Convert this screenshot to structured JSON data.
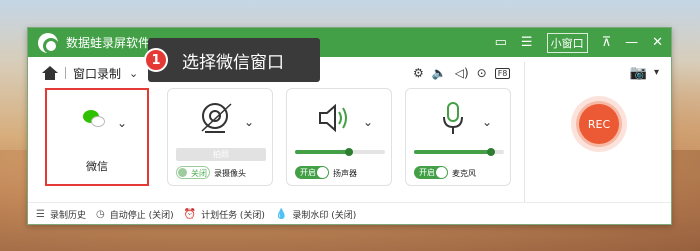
{
  "app": {
    "title": "数据蛙录屏软件"
  },
  "titlebar": {
    "mini_window": "小窗口",
    "menu_icon": "menu-icon",
    "pin_icon": "pin-icon"
  },
  "callout": {
    "number": "1",
    "text": "选择微信窗口"
  },
  "toolbar": {
    "mode": "窗口录制"
  },
  "sources": {
    "window": {
      "label": "微信"
    },
    "webcam": {
      "photo_button": "拍照",
      "toggle": "关闭",
      "label": "录摄像头"
    },
    "speaker": {
      "toggle": "开启",
      "label": "扬声器",
      "level": 0.6
    },
    "mic": {
      "toggle": "开启",
      "label": "麦克风",
      "level": 0.85
    }
  },
  "rec": {
    "label": "REC"
  },
  "bottombar": {
    "history": "录制历史",
    "auto_stop": "自动停止 (关闭)",
    "schedule": "计划任务 (关闭)",
    "watermark": "录制水印 (关闭)"
  },
  "colors": {
    "brand": "#43a047",
    "accent_red": "#e53935",
    "rec": "#eb5a34"
  }
}
